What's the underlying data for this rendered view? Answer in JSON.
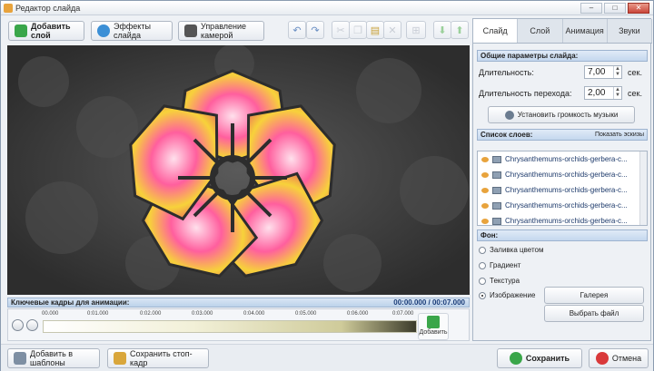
{
  "window": {
    "title": "Редактор слайда"
  },
  "toolbar": {
    "add_layer": "Добавить слой",
    "slide_effects": "Эффекты слайда",
    "camera_control": "Управление камерой"
  },
  "tabs": [
    "Слайд",
    "Слой",
    "Анимация",
    "Звуки"
  ],
  "general": {
    "header": "Общие параметры слайда:",
    "duration_label": "Длительность:",
    "duration_value": "7,00",
    "transition_label": "Длительность перехода:",
    "transition_value": "2,00",
    "unit": "сек.",
    "music_volume": "Установить громкость музыки"
  },
  "layers": {
    "header": "Список слоев:",
    "show_thumbs": "Показать эскизы",
    "items": [
      "Chrysanthemums-orchids-gerbera-c...",
      "Chrysanthemums-orchids-gerbera-c...",
      "Chrysanthemums-orchids-gerbera-c...",
      "Chrysanthemums-orchids-gerbera-c...",
      "Chrysanthemums-orchids-gerbera-c..."
    ]
  },
  "background": {
    "header": "Фон:",
    "fill": "Заливка цветом",
    "gradient": "Градиент",
    "texture": "Текстура",
    "image": "Изображение",
    "gallery": "Галерея",
    "choose_file": "Выбрать файл"
  },
  "keyframes": {
    "label": "Ключевые кадры для анимации:",
    "time": "00:00.000 / 00:07.000"
  },
  "timeline": {
    "ticks": [
      "00.000",
      "0:01.000",
      "0:02.000",
      "0:03.000",
      "0:04.000",
      "0:05.000",
      "0:06.000",
      "0:07.000"
    ],
    "add": "Добавить"
  },
  "bottom": {
    "add_templates": "Добавить в шаблоны",
    "save_frame": "Сохранить стоп-кадр",
    "save": "Сохранить",
    "cancel": "Отмена"
  }
}
